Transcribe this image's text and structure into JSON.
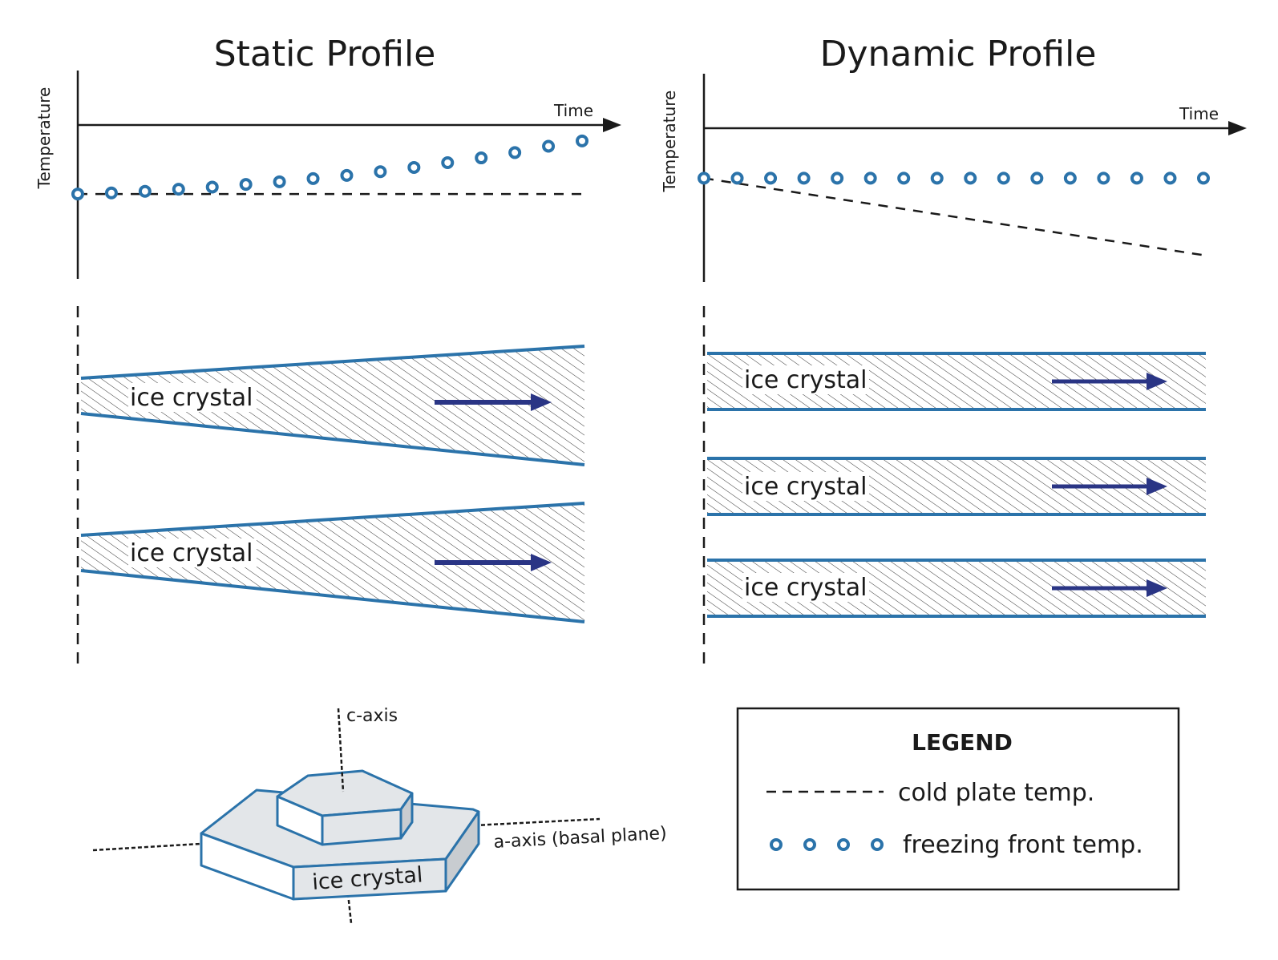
{
  "panels": {
    "static": {
      "title": "Static Profile",
      "y_axis_label": "Temperature",
      "x_axis_label": "Time",
      "crystal_label": "ice crystal"
    },
    "dynamic": {
      "title": "Dynamic Profile",
      "y_axis_label": "Temperature",
      "x_axis_label": "Time",
      "crystal_label": "ice crystal"
    }
  },
  "crystal_3d": {
    "c_axis_label": "c-axis",
    "a_axis_label": "a-axis (basal plane)",
    "body_label": "ice crystal"
  },
  "legend": {
    "title": "LEGEND",
    "items": [
      {
        "label": "cold plate temp.",
        "style": "dashed"
      },
      {
        "label": "freezing front temp.",
        "style": "circles"
      }
    ]
  },
  "colors": {
    "series_blue": "#2b73aa",
    "arrow_navy": "#2a3585",
    "axis": "#1a1a1a",
    "crystal_fill": "#e3e6e9",
    "crystal_side": "#cfd3d7"
  },
  "chart_data": [
    {
      "type": "line",
      "title": "Static Profile",
      "xlabel": "Time",
      "ylabel": "Temperature",
      "x": [
        0,
        1,
        2,
        3,
        4,
        5,
        6,
        7,
        8,
        9,
        10,
        11,
        12,
        13,
        14,
        15
      ],
      "series": [
        {
          "name": "cold plate temp.",
          "style": "dashed",
          "values": [
            0,
            0,
            0,
            0,
            0,
            0,
            0,
            0,
            0,
            0,
            0,
            0,
            0,
            0,
            0,
            0
          ]
        },
        {
          "name": "freezing front temp.",
          "style": "circles",
          "values": [
            0,
            0.02,
            0.05,
            0.09,
            0.13,
            0.18,
            0.23,
            0.29,
            0.35,
            0.42,
            0.5,
            0.59,
            0.68,
            0.78,
            0.9,
            1.0
          ]
        }
      ],
      "ylim": [
        -1.6,
        1.3
      ],
      "grid": false,
      "ticks": "none"
    },
    {
      "type": "line",
      "title": "Dynamic Profile",
      "xlabel": "Time",
      "ylabel": "Temperature",
      "x": [
        0,
        1,
        2,
        3,
        4,
        5,
        6,
        7,
        8,
        9,
        10,
        11,
        12,
        13,
        14,
        15
      ],
      "series": [
        {
          "name": "cold plate temp.",
          "style": "dashed",
          "values": [
            0,
            -0.07,
            -0.13,
            -0.2,
            -0.27,
            -0.33,
            -0.4,
            -0.47,
            -0.53,
            -0.6,
            -0.67,
            -0.73,
            -0.8,
            -0.87,
            -0.93,
            -1.0
          ]
        },
        {
          "name": "freezing front temp.",
          "style": "circles",
          "values": [
            0,
            0,
            0,
            0,
            0,
            0,
            0,
            0,
            0,
            0,
            0,
            0,
            0,
            0,
            0,
            0
          ]
        }
      ],
      "ylim": [
        -1.35,
        0.65
      ],
      "grid": false,
      "ticks": "none"
    }
  ]
}
